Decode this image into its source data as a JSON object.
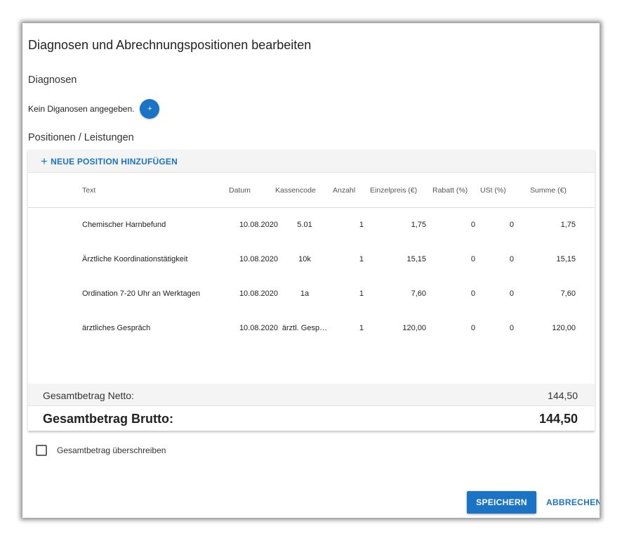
{
  "dialog": {
    "title": "Diagnosen und Abrechnungspositionen bearbeiten"
  },
  "diagnoses": {
    "section_label": "Diagnosen",
    "empty_text": "Kein Diganosen angegeben.",
    "add_label": "+"
  },
  "positions": {
    "section_label": "Positionen / Leistungen",
    "add_position_label": "NEUE POSITION HINZUFÜGEN",
    "add_position_icon": "plus-icon",
    "columns": {
      "text": "Text",
      "datum": "Datum",
      "kassencode": "Kassencode",
      "anzahl": "Anzahl",
      "einzelpreis": "Einzelpreis (€)",
      "rabatt": "Rabatt (%)",
      "ust": "USt (%)",
      "summe": "Summe (€)"
    },
    "rows": [
      {
        "text": "Chemischer Harnbefund",
        "datum": "10.08.2020",
        "kassencode": "5.01",
        "anzahl": "1",
        "einzelpreis": "1,75",
        "rabatt": "0",
        "ust": "0",
        "summe": "1,75"
      },
      {
        "text": "Ärztliche Koordinationstätigkeit",
        "datum": "10.08.2020",
        "kassencode": "10k",
        "anzahl": "1",
        "einzelpreis": "15,15",
        "rabatt": "0",
        "ust": "0",
        "summe": "15,15"
      },
      {
        "text": "Ordination 7-20 Uhr an Werktagen",
        "datum": "10.08.2020",
        "kassencode": "1a",
        "anzahl": "1",
        "einzelpreis": "7,60",
        "rabatt": "0",
        "ust": "0",
        "summe": "7,60"
      },
      {
        "text": "ärztliches Gespräch",
        "datum": "10.08.2020",
        "kassencode": "ärztl. Gesp…",
        "anzahl": "1",
        "einzelpreis": "120,00",
        "rabatt": "0",
        "ust": "0",
        "summe": "120,00"
      }
    ]
  },
  "totals": {
    "netto_label": "Gesamtbetrag Netto:",
    "netto_value": "144,50",
    "brutto_label": "Gesamtbetrag Brutto:",
    "brutto_value": "144,50"
  },
  "override": {
    "label": "Gesamtbetrag überschreiben",
    "checked": false
  },
  "actions": {
    "save_label": "SPEICHERN",
    "cancel_label": "ABBRECHEN"
  },
  "colors": {
    "accent": "#1a73c4"
  }
}
